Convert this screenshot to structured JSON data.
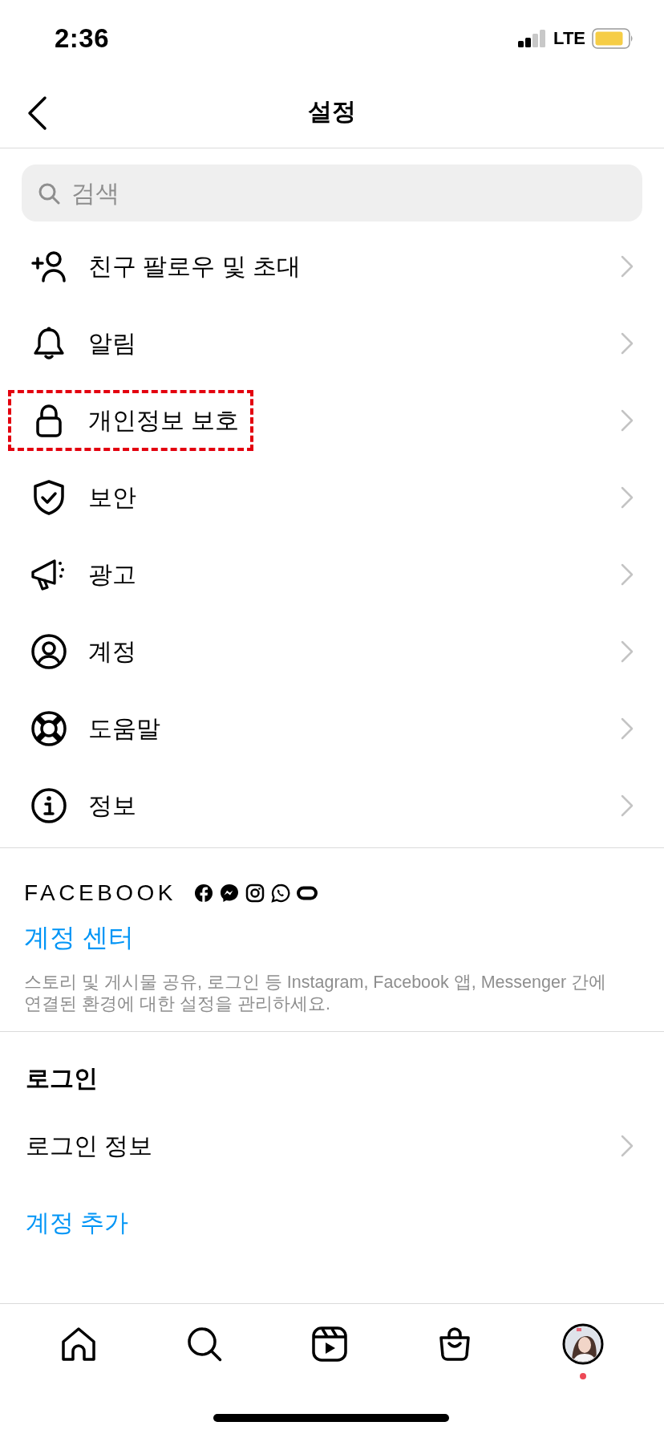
{
  "status_bar": {
    "time": "2:36",
    "network": "LTE"
  },
  "header": {
    "title": "설정"
  },
  "search": {
    "placeholder": "검색"
  },
  "menu": [
    {
      "label": "친구 팔로우 및 초대",
      "highlighted": false
    },
    {
      "label": "알림",
      "highlighted": false
    },
    {
      "label": "개인정보 보호",
      "highlighted": true
    },
    {
      "label": "보안",
      "highlighted": false
    },
    {
      "label": "광고",
      "highlighted": false
    },
    {
      "label": "계정",
      "highlighted": false
    },
    {
      "label": "도움말",
      "highlighted": false
    },
    {
      "label": "정보",
      "highlighted": false
    }
  ],
  "facebook": {
    "wordmark": "FACEBOOK",
    "link": "계정 센터",
    "description": "스토리 및 게시물 공유, 로그인 등 Instagram, Facebook 앱, Messenger 간에 연결된 환경에 대한 설정을 관리하세요."
  },
  "login": {
    "heading": "로그인",
    "items": [
      {
        "label": "로그인 정보",
        "kind": "row"
      },
      {
        "label": "계정 추가",
        "kind": "link"
      }
    ]
  },
  "tab_bar": {
    "profile_notification": true
  }
}
